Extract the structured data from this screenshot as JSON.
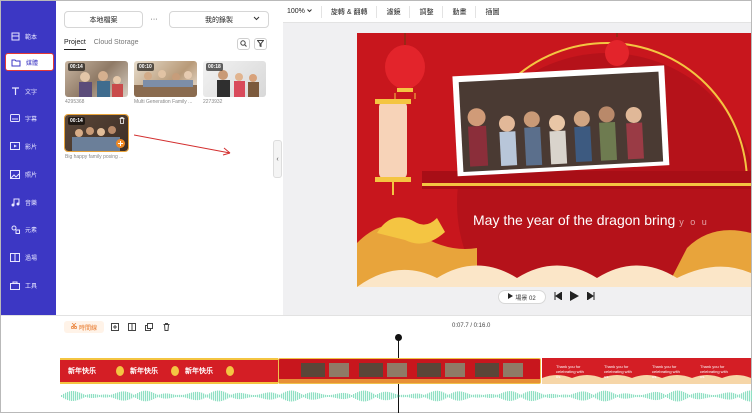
{
  "sidebar": {
    "items": [
      {
        "label": "範本",
        "icon": "template-icon"
      },
      {
        "label": "媒體",
        "icon": "folder-icon",
        "active": true
      },
      {
        "label": "文字",
        "icon": "text-icon"
      },
      {
        "label": "字幕",
        "icon": "subtitle-icon"
      },
      {
        "label": "影片",
        "icon": "video-icon"
      },
      {
        "label": "照片",
        "icon": "image-icon"
      },
      {
        "label": "音樂",
        "icon": "music-icon"
      },
      {
        "label": "元素",
        "icon": "elements-icon"
      },
      {
        "label": "過場",
        "icon": "transition-icon"
      },
      {
        "label": "工具",
        "icon": "tools-icon"
      }
    ]
  },
  "panel": {
    "local_files": "本地檔案",
    "more": "···",
    "my_recordings": "我的錄製",
    "tabs": [
      "Project",
      "Cloud Storage"
    ],
    "media": [
      {
        "duration": "00:14",
        "caption": "4295368"
      },
      {
        "duration": "00:10",
        "caption": "Multi Generation Family ..."
      },
      {
        "duration": "00:18",
        "caption": "2273932"
      },
      {
        "duration": "00:14",
        "caption": "Big happy family posing ..."
      }
    ]
  },
  "toolbar": {
    "zoom": "100%",
    "items": [
      "旋轉 & 翻轉",
      "濾鏡",
      "調整",
      "動畫",
      "插圖"
    ]
  },
  "stage": {
    "headline": "May the year of the dragon bring",
    "fade": "y o u"
  },
  "playback": {
    "scene": "場景 02"
  },
  "timeline": {
    "label": "時間線",
    "time": "0:07.7 / 0:16.0",
    "clip_text_a": "新年快乐",
    "clip_text_c": "Thank you for celebrating with us."
  },
  "colors": {
    "sidebar": "#3c37c4",
    "accent": "#e53935",
    "stage_red": "#c8161d",
    "gold": "#f4c542",
    "audio": "#8fe0c3"
  }
}
